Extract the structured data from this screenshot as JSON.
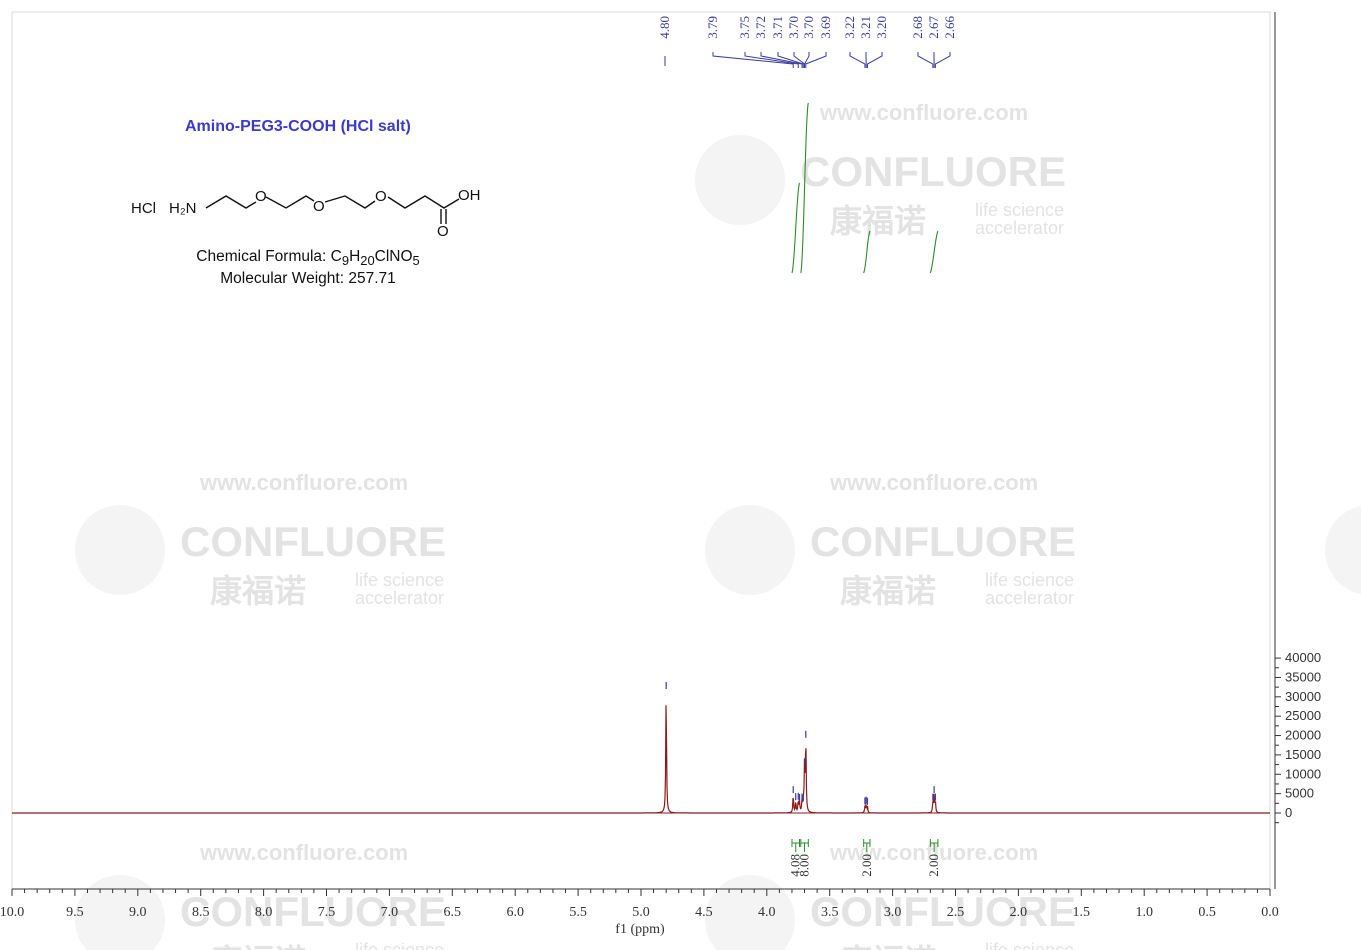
{
  "compound": {
    "name": "Amino-PEG3-COOH (HCl salt)",
    "hcl": "HCl",
    "amine": "H₂N",
    "oxygen": "O",
    "acid": "OH",
    "carbonyl": "O",
    "formula_label": "Chemical Formula: ",
    "formula": [
      "C",
      "9",
      "H",
      "20",
      "ClNO",
      "5"
    ],
    "mw_label": "Molecular Weight: ",
    "mw": "257.71"
  },
  "watermark": {
    "url": "www.confluore.com",
    "brand": "CONFLUORE",
    "cn": "康福诺",
    "tag1": "life science",
    "tag2": "accelerator"
  },
  "chart_data": {
    "type": "line",
    "xlabel": "f1 (ppm)",
    "xlim": [
      10.0,
      0.0
    ],
    "ylim": [
      -4000,
      41000
    ],
    "x_ticks": [
      "10.0",
      "9.5",
      "9.0",
      "8.5",
      "8.0",
      "7.5",
      "7.0",
      "6.5",
      "6.0",
      "5.5",
      "5.0",
      "4.5",
      "4.0",
      "3.5",
      "3.0",
      "2.5",
      "2.0",
      "1.5",
      "1.0",
      "0.5",
      "0.0"
    ],
    "y_ticks": [
      0,
      5000,
      10000,
      15000,
      20000,
      25000,
      30000,
      35000,
      40000
    ],
    "peaks": [
      {
        "ppm": 4.8,
        "height": 31500
      },
      {
        "ppm": 3.79,
        "height": 4600
      },
      {
        "ppm": 3.77,
        "height": 2800
      },
      {
        "ppm": 3.75,
        "height": 2900
      },
      {
        "ppm": 3.74,
        "height": 2600
      },
      {
        "ppm": 3.72,
        "height": 2700
      },
      {
        "ppm": 3.71,
        "height": 2500
      },
      {
        "ppm": 3.7,
        "height": 11800
      },
      {
        "ppm": 3.69,
        "height": 18900
      },
      {
        "ppm": 3.22,
        "height": 1700
      },
      {
        "ppm": 3.21,
        "height": 1900
      },
      {
        "ppm": 3.2,
        "height": 1600
      },
      {
        "ppm": 2.68,
        "height": 2700
      },
      {
        "ppm": 2.67,
        "height": 4600
      },
      {
        "ppm": 2.66,
        "height": 2700
      }
    ],
    "peak_labels": [
      {
        "group": "4.80",
        "ppm": [
          4.8
        ],
        "labels": [
          "4.80"
        ]
      },
      {
        "group": "3.7",
        "ppm": [
          3.79,
          3.75,
          3.72,
          3.71,
          3.7,
          3.7,
          3.69
        ],
        "labels": [
          "3.79",
          "3.75",
          "3.72",
          "3.71",
          "3.70",
          "3.70",
          "3.69"
        ]
      },
      {
        "group": "3.2",
        "ppm": [
          3.22,
          3.21,
          3.2
        ],
        "labels": [
          "3.22",
          "3.21",
          "3.20"
        ]
      },
      {
        "group": "2.67",
        "ppm": [
          2.68,
          2.67,
          2.66
        ],
        "labels": [
          "2.68",
          "2.67",
          "2.66"
        ]
      }
    ],
    "integrals": [
      {
        "from": 3.8,
        "to": 3.74,
        "value": "4.08"
      },
      {
        "from": 3.73,
        "to": 3.67,
        "value": "8.00"
      },
      {
        "from": 3.23,
        "to": 3.18,
        "value": "2.00"
      },
      {
        "from": 2.7,
        "to": 2.64,
        "value": "2.00"
      }
    ],
    "colors": {
      "spectrum": "#8b1a1a",
      "label": "#3a3aa0",
      "integral": "#2d8a2d",
      "axis": "#333333"
    }
  }
}
